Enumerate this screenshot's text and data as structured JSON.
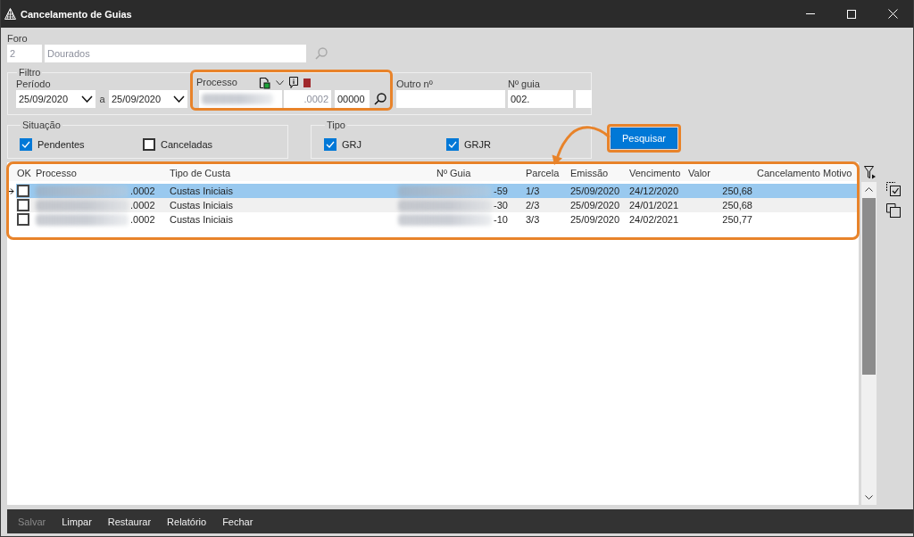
{
  "window": {
    "title": "Cancelamento de Guias"
  },
  "foro": {
    "label": "Foro",
    "code": "2",
    "name": "Dourados",
    "disabled": true
  },
  "filtro": {
    "title": "Filtro",
    "periodo": {
      "label": "Período",
      "from": "25/09/2020",
      "separator": "a",
      "to": "25/09/2020"
    },
    "processo": {
      "label": "Processo",
      "fields": [
        {
          "kind": "redacted"
        },
        {
          "kind": "text",
          "value": ".0002",
          "disabled": true
        },
        {
          "kind": "text",
          "value": "00000",
          "disabled": false
        }
      ]
    },
    "outro_numero": {
      "label": "Outro nº"
    },
    "numero_guia": {
      "label": "Nº guia",
      "value": "002."
    }
  },
  "situacao": {
    "title": "Situação",
    "options": [
      {
        "label": "Pendentes",
        "checked": true
      },
      {
        "label": "Canceladas",
        "checked": false
      }
    ]
  },
  "tipo": {
    "title": "Tipo",
    "options": [
      {
        "label": "GRJ",
        "checked": true
      },
      {
        "label": "GRJR",
        "checked": true
      }
    ]
  },
  "search_button": {
    "label": "Pesquisar"
  },
  "table": {
    "columns": [
      "OK",
      "Processo",
      "Tipo de Custa",
      "Nº Guia",
      "Parcela",
      "Emissão",
      "Vencimento",
      "Valor",
      "Cancelamento Motivo"
    ],
    "rows": [
      {
        "current": true,
        "selected": true,
        "checked": false,
        "processo": ".0002",
        "tipo_de_custa": "Custas Iniciais",
        "numero_guia": "-59",
        "parcela": "1/3",
        "emissao": "25/09/2020",
        "vencimento": "24/12/2020",
        "valor": "250,68"
      },
      {
        "current": false,
        "selected": false,
        "checked": false,
        "processo": ".0002",
        "tipo_de_custa": "Custas Iniciais",
        "numero_guia": "-30",
        "parcela": "2/3",
        "emissao": "25/09/2020",
        "vencimento": "24/01/2021",
        "valor": "250,68"
      },
      {
        "current": false,
        "selected": false,
        "checked": false,
        "processo": ".0002",
        "tipo_de_custa": "Custas Iniciais",
        "numero_guia": "-10",
        "parcela": "3/3",
        "emissao": "25/09/2020",
        "vencimento": "24/02/2021",
        "valor": "250,77"
      }
    ]
  },
  "footer": {
    "buttons": [
      {
        "label": "Salvar",
        "disabled": true
      },
      {
        "label": "Limpar",
        "disabled": false
      },
      {
        "label": "Restaurar",
        "disabled": false
      },
      {
        "label": "Relatório",
        "disabled": false
      },
      {
        "label": "Fechar",
        "disabled": false
      }
    ]
  }
}
